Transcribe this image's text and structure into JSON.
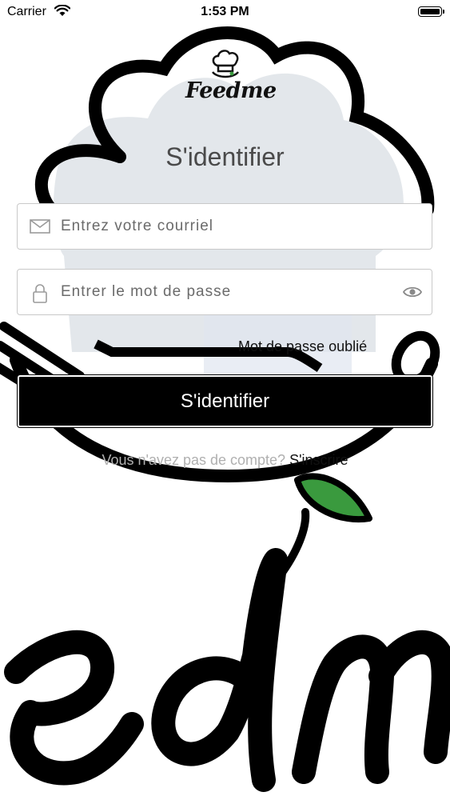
{
  "status_bar": {
    "carrier": "Carrier",
    "time": "1:53 PM"
  },
  "brand": {
    "name": "Feedme"
  },
  "login": {
    "title": "S'identifier",
    "email_placeholder": "Entrez votre courriel",
    "password_placeholder": "Entrer le mot de passe",
    "forgot_password": "Mot de passe oublié",
    "submit_label": "S'identifier",
    "signup_question": "Vous n'avez pas de compte? ",
    "signup_link": "S'inscrire"
  },
  "colors": {
    "button_bg": "#000000",
    "leaf_green": "#3a9a3e",
    "cloud_fill": "#e3e7eb"
  }
}
